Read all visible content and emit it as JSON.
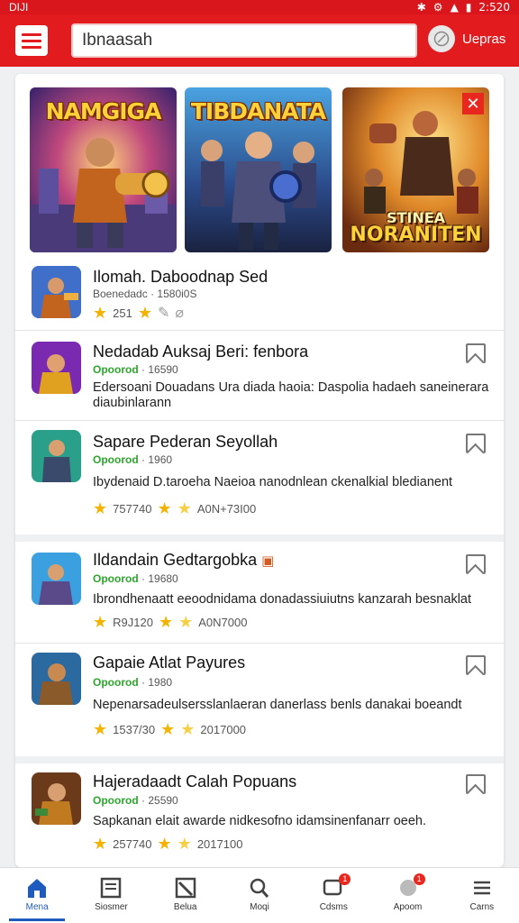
{
  "status_bar": {
    "left": "DIJI",
    "time": "2:520",
    "icons": [
      "bluetooth-icon",
      "settings-icon",
      "signal-icon",
      "battery-icon"
    ]
  },
  "app_bar": {
    "search_value": "Ibnaasah",
    "account_label": "Uepras"
  },
  "banners": [
    {
      "title": "NAMGIGA"
    },
    {
      "title": "TIBDANATA"
    },
    {
      "title_line1": "STINEA",
      "title_line2": "NORANITEN"
    }
  ],
  "rows": [
    {
      "name": "Ilomah. Daboodnap Sed",
      "publisher": "Boenedadc",
      "count": "1580i0S",
      "rating": "251",
      "has_bookmark": false
    },
    {
      "name": "Nedadab Auksaj Beri: fenbora",
      "publisher": "Opoorod",
      "count": "16590",
      "desc_line1": "Edersoani Douadans Ura diada haoia: Daspolia hadaeh saneinerarai",
      "desc_line2": "diaubinlarann",
      "has_bookmark": true
    },
    {
      "name": "Sapare Pederan Seyollah",
      "publisher": "Opoorod",
      "count": "1960",
      "desc_line1": "Ibydenaid D.taroeha Naeioa nanodnlean ckenalkial bledianent",
      "rating": "757740",
      "extra": "A0N+73I00",
      "has_bookmark": true
    },
    {
      "name": "Ildandain Gedtargobka",
      "publisher": "Opoorod",
      "count": "19680",
      "desc_line1": "Ibrondhenaatt eeoodnidama donadassiuiutns kanzarah besnaklat",
      "rating": "R9J120",
      "extra": "A0N7000",
      "has_bookmark": true
    },
    {
      "name": "Gapaie Atlat Payures",
      "publisher": "Opoorod",
      "count": "1980",
      "desc_line1": "Nepenarsadeulsersslanlaeran danerlass benls danakai boeandt",
      "rating": "1537/30",
      "extra": "2017000",
      "has_bookmark": true
    },
    {
      "name": "Hajeradaadt Calah Popuans",
      "publisher": "Opoorod",
      "count": "25590",
      "desc_line1": "Sapkanan elait awarde nidkesofno idamsinenfanarr oeeh.",
      "rating": "257740",
      "extra": "2017100",
      "has_bookmark": true
    }
  ],
  "bottom_nav": [
    {
      "label": "Mena",
      "icon": "home-icon",
      "active": true
    },
    {
      "label": "Siosmer",
      "icon": "document-icon",
      "active": false
    },
    {
      "label": "Belua",
      "icon": "edit-icon",
      "active": false
    },
    {
      "label": "Moqi",
      "icon": "search-icon",
      "active": false
    },
    {
      "label": "Cdsms",
      "icon": "chat-icon",
      "active": false,
      "badge": "1"
    },
    {
      "label": "Apoom",
      "icon": "user-icon",
      "active": false,
      "badge": "1"
    },
    {
      "label": "Carns",
      "icon": "list-icon",
      "active": false
    }
  ]
}
